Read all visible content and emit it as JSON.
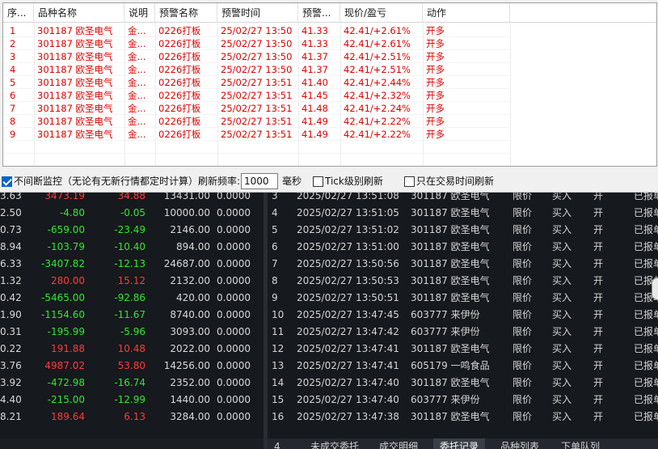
{
  "alert": {
    "columns": [
      "序...",
      "品种名称",
      "说明",
      "预警名称",
      "预警时间",
      "预警...",
      "现价/盈亏",
      "动作"
    ],
    "rows": [
      {
        "seq": "1",
        "name": "301187 欧圣电气",
        "desc": "金...",
        "alert": "0226打板",
        "time": "25/02/27 13:50",
        "price": "41.33",
        "pnl": "42.41/+2.61%",
        "action": "开多"
      },
      {
        "seq": "2",
        "name": "301187 欧圣电气",
        "desc": "金...",
        "alert": "0226打板",
        "time": "25/02/27 13:50",
        "price": "41.33",
        "pnl": "42.41/+2.61%",
        "action": "开多"
      },
      {
        "seq": "3",
        "name": "301187 欧圣电气",
        "desc": "金...",
        "alert": "0226打板",
        "time": "25/02/27 13:50",
        "price": "41.37",
        "pnl": "42.41/+2.51%",
        "action": "开多"
      },
      {
        "seq": "4",
        "name": "301187 欧圣电气",
        "desc": "金...",
        "alert": "0226打板",
        "time": "25/02/27 13:50",
        "price": "41.37",
        "pnl": "42.41/+2.51%",
        "action": "开多"
      },
      {
        "seq": "5",
        "name": "301187 欧圣电气",
        "desc": "金...",
        "alert": "0226打板",
        "time": "25/02/27 13:51",
        "price": "41.40",
        "pnl": "42.41/+2.44%",
        "action": "开多"
      },
      {
        "seq": "6",
        "name": "301187 欧圣电气",
        "desc": "金...",
        "alert": "0226打板",
        "time": "25/02/27 13:51",
        "price": "41.45",
        "pnl": "42.41/+2.32%",
        "action": "开多"
      },
      {
        "seq": "7",
        "name": "301187 欧圣电气",
        "desc": "金...",
        "alert": "0226打板",
        "time": "25/02/27 13:51",
        "price": "41.48",
        "pnl": "42.41/+2.24%",
        "action": "开多"
      },
      {
        "seq": "8",
        "name": "301187 欧圣电气",
        "desc": "金...",
        "alert": "0226打板",
        "time": "25/02/27 13:51",
        "price": "41.49",
        "pnl": "42.41/+2.22%",
        "action": "开多"
      },
      {
        "seq": "9",
        "name": "301187 欧圣电气",
        "desc": "金...",
        "alert": "0226打板",
        "time": "25/02/27 13:51",
        "price": "41.49",
        "pnl": "42.41/+2.22%",
        "action": "开多"
      }
    ]
  },
  "controls": {
    "monitor_label": "不间断监控（无论有无新行情都定时计算）刷新频率:",
    "monitor_checked": true,
    "refresh_value": "1000",
    "unit_label": "毫秒",
    "tick_label": "Tick级别刷新",
    "tick_checked": false,
    "trade_time_label": "只在交易时间刷新",
    "trade_time_checked": false
  },
  "left_table": [
    {
      "a": "3.63",
      "b": "3473.19",
      "c": "34.88",
      "d": "13431.00",
      "e": "0.0000",
      "sign": "pos"
    },
    {
      "a": "2.50",
      "b": "-4.80",
      "c": "-0.05",
      "d": "10000.00",
      "e": "0.0000",
      "sign": "neg"
    },
    {
      "a": "0.73",
      "b": "-659.00",
      "c": "-23.49",
      "d": "2146.00",
      "e": "0.0000",
      "sign": "neg"
    },
    {
      "a": "8.94",
      "b": "-103.79",
      "c": "-10.40",
      "d": "894.00",
      "e": "0.0000",
      "sign": "neg"
    },
    {
      "a": "6.33",
      "b": "-3407.82",
      "c": "-12.13",
      "d": "24687.00",
      "e": "0.0000",
      "sign": "neg"
    },
    {
      "a": "1.32",
      "b": "280.00",
      "c": "15.12",
      "d": "2132.00",
      "e": "0.0000",
      "sign": "pos"
    },
    {
      "a": "0.42",
      "b": "-5465.00",
      "c": "-92.86",
      "d": "420.00",
      "e": "0.0000",
      "sign": "neg"
    },
    {
      "a": "1.90",
      "b": "-1154.60",
      "c": "-11.67",
      "d": "8740.00",
      "e": "0.0000",
      "sign": "neg"
    },
    {
      "a": "0.31",
      "b": "-195.99",
      "c": "-5.96",
      "d": "3093.00",
      "e": "0.0000",
      "sign": "neg"
    },
    {
      "a": "0.22",
      "b": "191.88",
      "c": "10.48",
      "d": "2022.00",
      "e": "0.0000",
      "sign": "pos"
    },
    {
      "a": "3.76",
      "b": "4987.02",
      "c": "53.80",
      "d": "14256.00",
      "e": "0.0000",
      "sign": "pos"
    },
    {
      "a": "3.92",
      "b": "-472.98",
      "c": "-16.74",
      "d": "2352.00",
      "e": "0.0000",
      "sign": "neg"
    },
    {
      "a": "4.40",
      "b": "-215.00",
      "c": "-12.99",
      "d": "1440.00",
      "e": "0.0000",
      "sign": "neg"
    },
    {
      "a": "8.21",
      "b": "189.64",
      "c": "6.13",
      "d": "3284.00",
      "e": "0.0000",
      "sign": "pos"
    }
  ],
  "right_table": [
    {
      "n": "3",
      "time": "2025/02/27 13:51:08",
      "stock": "301187 欧圣电气",
      "type": "限价",
      "side": "买入",
      "oc": "开",
      "status": "已报单"
    },
    {
      "n": "4",
      "time": "2025/02/27 13:51:05",
      "stock": "301187 欧圣电气",
      "type": "限价",
      "side": "买入",
      "oc": "开",
      "status": "已报单"
    },
    {
      "n": "5",
      "time": "2025/02/27 13:51:02",
      "stock": "301187 欧圣电气",
      "type": "限价",
      "side": "买入",
      "oc": "开",
      "status": "已报单"
    },
    {
      "n": "6",
      "time": "2025/02/27 13:51:00",
      "stock": "301187 欧圣电气",
      "type": "限价",
      "side": "买入",
      "oc": "开",
      "status": "已报单"
    },
    {
      "n": "7",
      "time": "2025/02/27 13:50:56",
      "stock": "301187 欧圣电气",
      "type": "限价",
      "side": "买入",
      "oc": "开",
      "status": "已报单"
    },
    {
      "n": "8",
      "time": "2025/02/27 13:50:53",
      "stock": "301187 欧圣电气",
      "type": "限价",
      "side": "买入",
      "oc": "开",
      "status": "已报单"
    },
    {
      "n": "9",
      "time": "2025/02/27 13:50:51",
      "stock": "301187 欧圣电气",
      "type": "限价",
      "side": "买入",
      "oc": "开",
      "status": "已报单"
    },
    {
      "n": "10",
      "time": "2025/02/27 13:47:45",
      "stock": "603777 来伊份",
      "type": "限价",
      "side": "买入",
      "oc": "开",
      "status": "已报单"
    },
    {
      "n": "11",
      "time": "2025/02/27 13:47:42",
      "stock": "603777 来伊份",
      "type": "限价",
      "side": "买入",
      "oc": "开",
      "status": "已报单"
    },
    {
      "n": "12",
      "time": "2025/02/27 13:47:41",
      "stock": "301187 欧圣电气",
      "type": "限价",
      "side": "买入",
      "oc": "开",
      "status": "已报单"
    },
    {
      "n": "13",
      "time": "2025/02/27 13:47:41",
      "stock": "605179 一鸣食品",
      "type": "限价",
      "side": "买入",
      "oc": "开",
      "status": "已报单"
    },
    {
      "n": "14",
      "time": "2025/02/27 13:47:40",
      "stock": "301187 欧圣电气",
      "type": "限价",
      "side": "买入",
      "oc": "开",
      "status": "已报单"
    },
    {
      "n": "15",
      "time": "2025/02/27 13:47:40",
      "stock": "603777 来伊份",
      "type": "限价",
      "side": "买入",
      "oc": "开",
      "status": "已报单"
    },
    {
      "n": "16",
      "time": "2025/02/27 13:47:38",
      "stock": "301187 欧圣电气",
      "type": "限价",
      "side": "买入",
      "oc": "开",
      "status": "已报单"
    }
  ],
  "bottom_tabs": [
    {
      "label": "4",
      "active": false
    },
    {
      "label": "未成交委托",
      "active": false
    },
    {
      "label": "成交明细",
      "active": false
    },
    {
      "label": "委托记录",
      "active": true
    },
    {
      "label": "品种列表",
      "active": false
    },
    {
      "label": "下单队列",
      "active": false
    }
  ],
  "colors": {
    "alert_text": "#e00000",
    "up": "#ff3a3a",
    "down": "#33e633",
    "dark_bg": "#16191d"
  }
}
